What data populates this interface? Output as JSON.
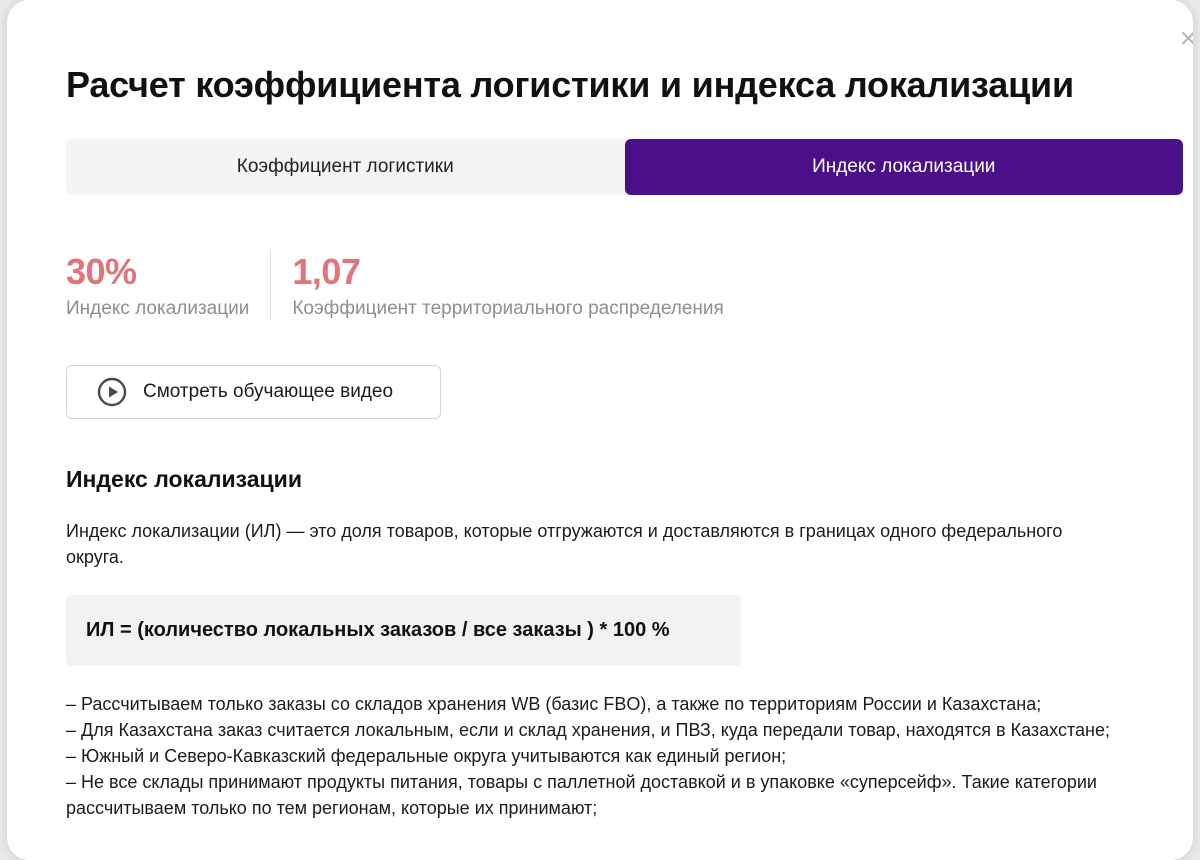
{
  "modal": {
    "close_icon": "close-icon",
    "title": "Расчет коэффициента логистики и индекса локализации"
  },
  "tabs": [
    {
      "label": "Коэффициент логистики",
      "active": false
    },
    {
      "label": "Индекс локализации",
      "active": true
    }
  ],
  "stats": [
    {
      "value": "30%",
      "label": "Индекс локализации"
    },
    {
      "value": "1,07",
      "label": "Коэффициент территориального распределения"
    }
  ],
  "video_button": {
    "icon": "play-circle-icon",
    "label": "Смотреть обучающее видео"
  },
  "section": {
    "title": "Индекс локализации",
    "intro": "Индекс локализации (ИЛ) — это доля товаров, которые отгружаются и доставляются в границах одного федерального округа.",
    "formula": "ИЛ = (количество локальных заказов / все заказы ) * 100 %",
    "rules": [
      "– Рассчитываем только заказы со складов хранения WB (базис FBO), а также по территориям России и Казахстана;",
      "– Для Казахстана заказ считается локальным, если и склад хранения, и ПВЗ, куда передали товар, находятся в Казахстане;",
      "– Южный и Северо-Кавказский федеральные округа учитываются как единый регион;",
      "– Не все склады принимают продукты питания, товары с паллетной доставкой и в упаковке «суперсейф». Такие категории рассчитываем только по тем регионам, которые их принимают;"
    ]
  },
  "colors": {
    "accent_tab": "#4b0f8a",
    "stat_value": "#e0757b",
    "muted_text": "#8e8e93"
  }
}
